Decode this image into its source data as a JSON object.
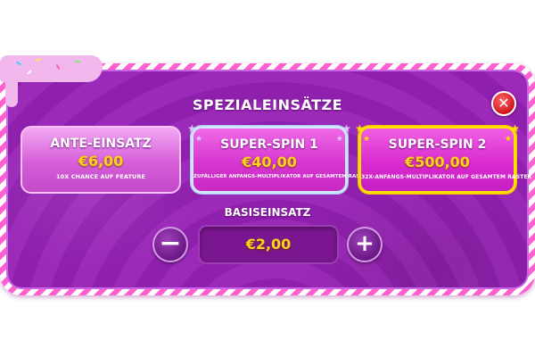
{
  "dialog": {
    "title": "SPEZIALEINSÄTZE",
    "close_icon": "close-x-icon"
  },
  "cards": [
    {
      "title": "ANTE-EINSATZ",
      "price": "€6,00",
      "desc": "10X CHANCE AUF FEATURE"
    },
    {
      "title": "SUPER-SPIN 1",
      "price": "€40,00",
      "desc": "ZUFÄLLIGER ANFANGS-MULTIPLIKATOR AUF GESAMTEM RASTER"
    },
    {
      "title": "SUPER-SPIN 2",
      "price": "€500,00",
      "desc": "32X-ANFANGS-MULTIPLIKATOR AUF GESAMTEM RASTER"
    }
  ],
  "base_bet": {
    "label": "BASISEINSATZ",
    "value": "€2,00",
    "minus_label": "−",
    "plus_label": "+"
  },
  "colors": {
    "panel": "#9b2ab8",
    "price": "#ffd21f",
    "selected_border": "#ffe200",
    "close": "#d0141c"
  }
}
